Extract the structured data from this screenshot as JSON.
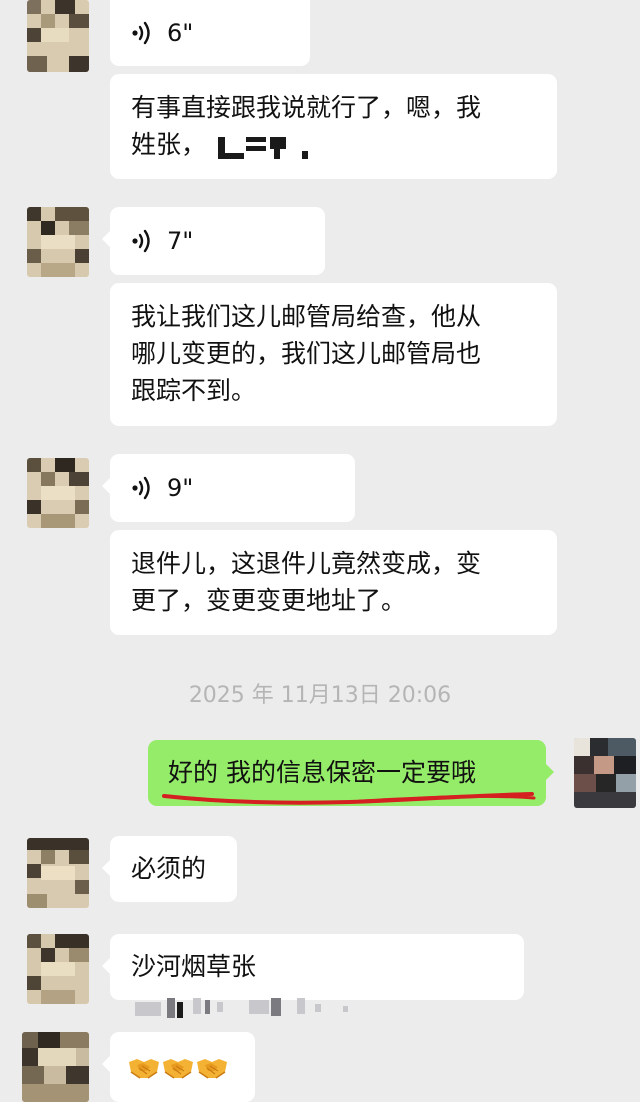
{
  "messages": [
    {
      "id": "m1",
      "side": "left",
      "type": "voice",
      "duration": "6\""
    },
    {
      "id": "m2",
      "side": "left",
      "type": "text",
      "lines": [
        "有事直接跟我说就行了，嗯，我",
        "姓张，"
      ]
    },
    {
      "id": "m3",
      "side": "left",
      "type": "voice",
      "duration": "7\""
    },
    {
      "id": "m4",
      "side": "left",
      "type": "text",
      "lines": [
        "我让我们这儿邮管局给查，他从",
        "哪儿变更的，我们这儿邮管局也",
        "跟踪不到。"
      ]
    },
    {
      "id": "m5",
      "side": "left",
      "type": "voice",
      "duration": "9\""
    },
    {
      "id": "m6",
      "side": "left",
      "type": "text",
      "lines": [
        "退件儿，这退件儿竟然变成，变",
        "更了，变更变更地址了。"
      ]
    },
    {
      "id": "ts",
      "type": "timestamp",
      "text": "2025 年 11月13日 20:06"
    },
    {
      "id": "m7",
      "side": "right",
      "type": "text",
      "lines": [
        "好的 我的信息保密一定要哦"
      ]
    },
    {
      "id": "m8",
      "side": "left",
      "type": "text",
      "lines": [
        "必须的"
      ]
    },
    {
      "id": "m9",
      "side": "left",
      "type": "text",
      "lines": [
        "沙河烟草张"
      ]
    },
    {
      "id": "m10",
      "side": "left",
      "type": "emoji",
      "emojis": [
        "handshake",
        "handshake",
        "handshake"
      ]
    }
  ],
  "colors": {
    "background": "#ececec",
    "bubble_left": "#ffffff",
    "bubble_right": "#95ec69",
    "timestamp": "#b5b5b5",
    "annotation": "#d42020"
  },
  "icons": [
    "voice-wave-icon",
    "handshake-emoji",
    "avatar"
  ]
}
